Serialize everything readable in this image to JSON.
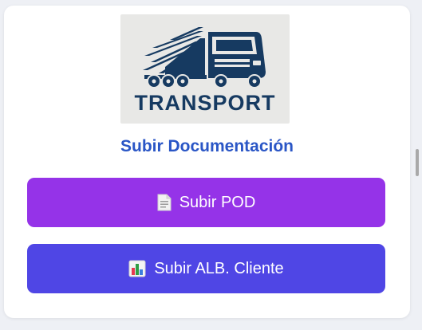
{
  "logo": {
    "text": "TRANSPORT",
    "colors": {
      "primary": "#163a61",
      "background": "#e8e8e6"
    }
  },
  "section": {
    "title": "Subir Documentación"
  },
  "buttons": {
    "pod": {
      "label": "Subir POD",
      "icon": "document-icon",
      "color": "#9533e8"
    },
    "alb": {
      "label": "Subir ALB. Cliente",
      "icon": "bar-chart-icon",
      "color": "#4f46e5"
    }
  },
  "colors": {
    "title": "#2a56c6",
    "page_background": "#eef0f5",
    "card_background": "#ffffff"
  }
}
